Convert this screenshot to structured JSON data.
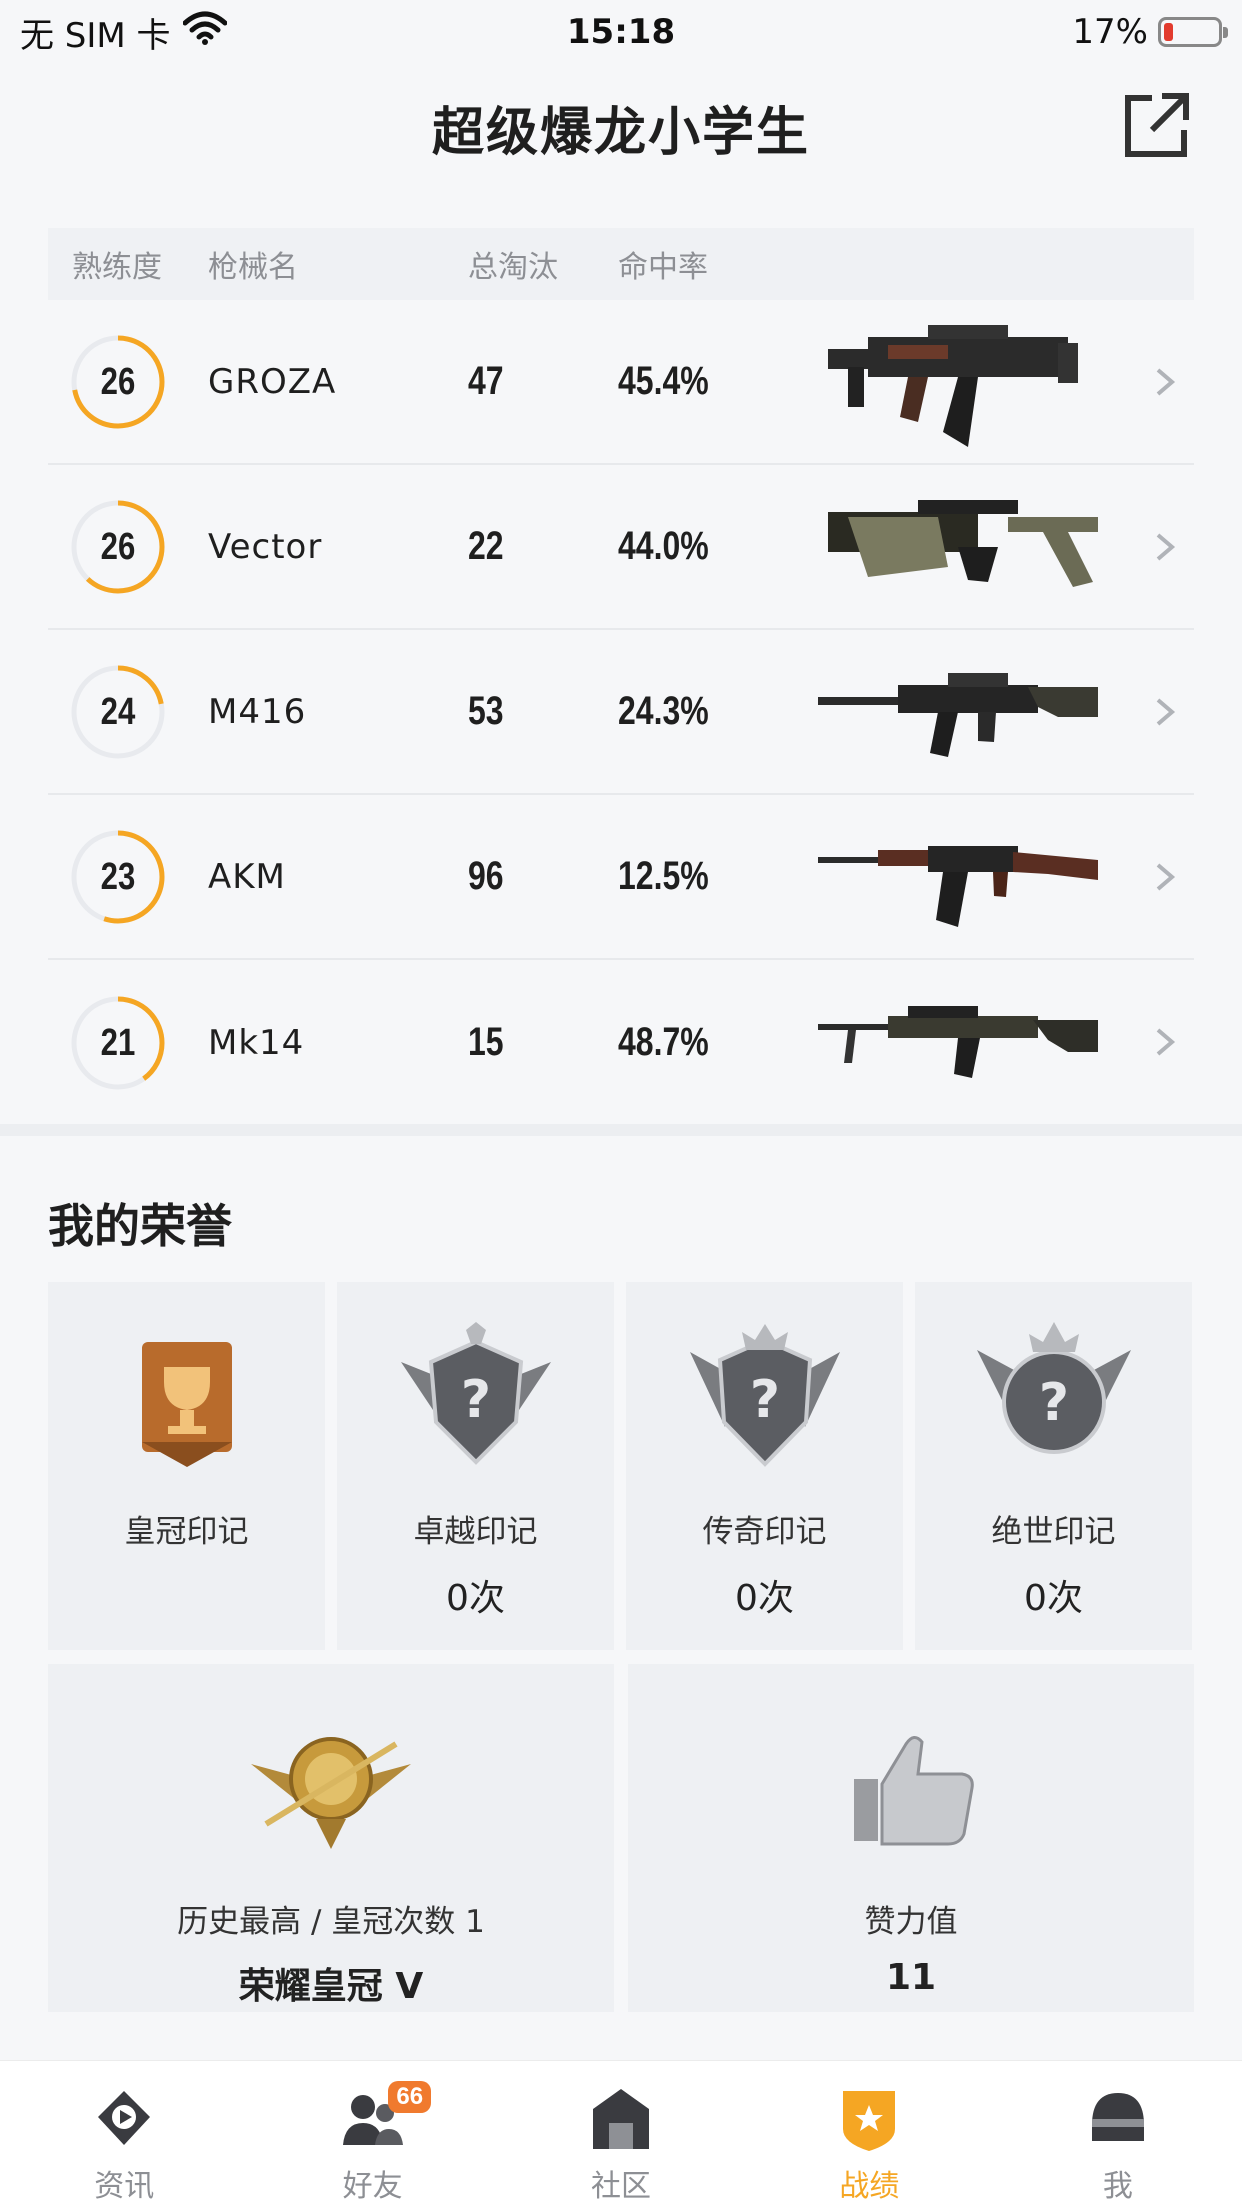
{
  "status_bar": {
    "carrier": "无 SIM 卡",
    "time": "15:18",
    "battery": "17%"
  },
  "header": {
    "title": "超级爆龙小学生"
  },
  "weapon_table": {
    "columns": [
      "熟练度",
      "枪械名",
      "总淘汰",
      "命中率"
    ],
    "rows": [
      {
        "level": "26",
        "level_progress": 0.72,
        "name": "GROZA",
        "kills": "47",
        "accuracy": "45.4%",
        "icon": "groza-gun-icon"
      },
      {
        "level": "26",
        "level_progress": 0.62,
        "name": "Vector",
        "kills": "22",
        "accuracy": "44.0%",
        "icon": "vector-gun-icon"
      },
      {
        "level": "24",
        "level_progress": 0.22,
        "name": "M416",
        "kills": "53",
        "accuracy": "24.3%",
        "icon": "m416-gun-icon"
      },
      {
        "level": "23",
        "level_progress": 0.55,
        "name": "AKM",
        "kills": "96",
        "accuracy": "12.5%",
        "icon": "akm-gun-icon"
      },
      {
        "level": "21",
        "level_progress": 0.4,
        "name": "Mk14",
        "kills": "15",
        "accuracy": "48.7%",
        "icon": "mk14-gun-icon"
      }
    ]
  },
  "honors": {
    "title": "我的荣誉",
    "medals": [
      {
        "name": "皇冠印记",
        "count": ""
      },
      {
        "name": "卓越印记",
        "count": "0次"
      },
      {
        "name": "传奇印记",
        "count": "0次"
      },
      {
        "name": "绝世印记",
        "count": "0次"
      }
    ],
    "highest": {
      "label": "历史最高 / 皇冠次数 1",
      "value": "荣耀皇冠 V"
    },
    "likes": {
      "label": "赞力值",
      "value": "11"
    }
  },
  "tabs": [
    {
      "label": "资讯"
    },
    {
      "label": "好友",
      "badge": "66"
    },
    {
      "label": "社区"
    },
    {
      "label": "战绩"
    },
    {
      "label": "我"
    }
  ],
  "colors": {
    "accent": "#f5a623",
    "ring_track": "#e8eaee",
    "badge": "#f07a2e"
  }
}
